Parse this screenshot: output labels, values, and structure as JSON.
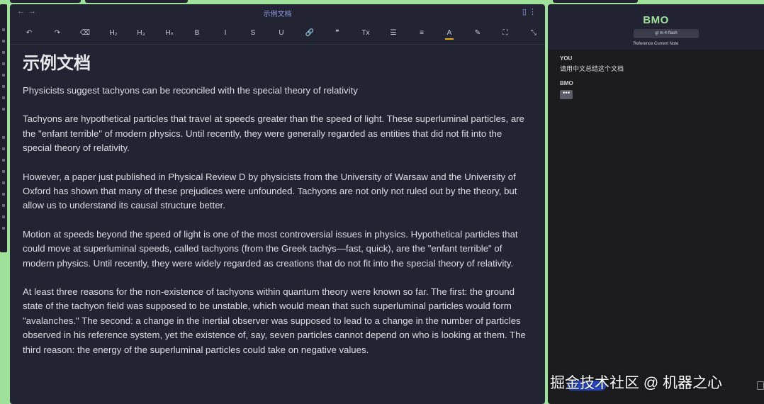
{
  "editor": {
    "tab_title": "示例文档",
    "toolbar": [
      {
        "name": "undo-icon",
        "glyph": "↶"
      },
      {
        "name": "redo-icon",
        "glyph": "↷"
      },
      {
        "name": "clear-format-icon",
        "glyph": "⌫"
      },
      {
        "name": "heading-2-icon",
        "glyph": "H₂"
      },
      {
        "name": "heading-3-icon",
        "glyph": "H₃"
      },
      {
        "name": "heading-n-icon",
        "glyph": "Hₙ"
      },
      {
        "name": "bold-icon",
        "glyph": "B"
      },
      {
        "name": "italic-icon",
        "glyph": "I"
      },
      {
        "name": "strikethrough-icon",
        "glyph": "S"
      },
      {
        "name": "underline-icon",
        "glyph": "U"
      },
      {
        "name": "link-icon",
        "glyph": "🔗"
      },
      {
        "name": "quote-icon",
        "glyph": "❞"
      },
      {
        "name": "clear-icon",
        "glyph": "Tx"
      },
      {
        "name": "bullet-list-icon",
        "glyph": "☰"
      },
      {
        "name": "align-icon",
        "glyph": "≡"
      },
      {
        "name": "text-color-icon",
        "glyph": "A"
      },
      {
        "name": "highlight-icon",
        "glyph": "✎"
      },
      {
        "name": "fullscreen-icon",
        "glyph": "⛶"
      },
      {
        "name": "exit-fullscreen-icon",
        "glyph": "⤡"
      }
    ],
    "heading": "示例文档",
    "paragraphs": [
      "Physicists suggest tachyons can be reconciled with the special theory of relativity",
      "Tachyons are hypothetical particles that travel at speeds greater than the speed of light. These superluminal particles, are the \"enfant terrible\" of modern physics. Until recently, they were generally regarded as entities that did not fit into the special theory of relativity.",
      "However, a paper just published in Physical Review D by physicists from the University of Warsaw and the University of Oxford has shown that many of these prejudices were unfounded. Tachyons are not only not ruled out by the theory, but allow us to understand its causal structure better.",
      "Motion at speeds beyond the speed of light is one of the most controversial issues in physics. Hypothetical particles that could move at superluminal speeds, called tachyons (from the Greek tachýs—fast, quick), are the \"enfant terrible\" of modern physics. Until recently, they were widely regarded as creations that do not fit into the special theory of relativity.",
      "At least three reasons for the non-existence of tachyons within quantum theory were known so far. The first: the ground state of the tachyon field was supposed to be unstable, which would mean that such superluminal particles would form \"avalanches.\" The second: a change in the inertial observer was supposed to lead to a change in the number of particles observed in his reference system, yet the existence of, say, seven particles cannot depend on who is looking at them. The third reason: the energy of the superluminal particles could take on negative values."
    ]
  },
  "chat": {
    "bot_name": "BMO",
    "model": "gl m-4-flash",
    "reference_note": "Reference Current Note",
    "messages": [
      {
        "sender": "YOU",
        "text": "请用中文总结这个文档"
      },
      {
        "sender": "BMO",
        "text": "•••"
      }
    ]
  },
  "watermark": "掘金技术社区 @ 机器之心",
  "colors": {
    "background": "#9fe09a",
    "editor_bg": "#232433",
    "chat_bg": "#1c1c1e",
    "accent_green": "#9fe09a",
    "accent_blue": "#8c9ae0"
  }
}
